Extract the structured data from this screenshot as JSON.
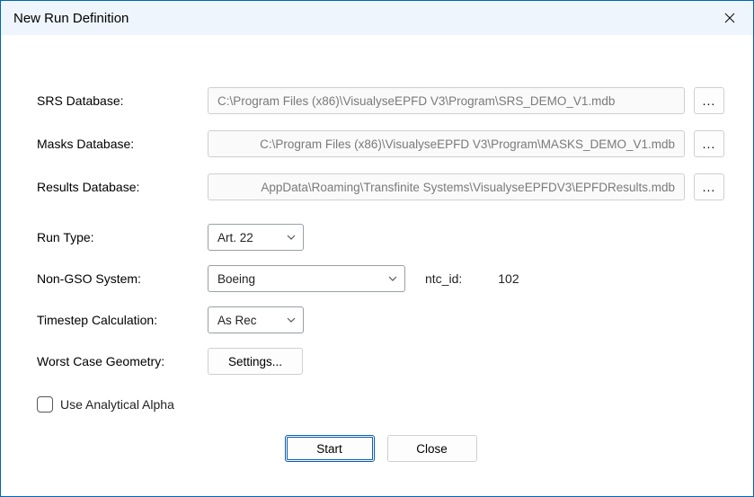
{
  "window": {
    "title": "New Run Definition"
  },
  "labels": {
    "srs_database": "SRS Database:",
    "masks_database": "Masks Database:",
    "results_database": "Results Database:",
    "run_type": "Run Type:",
    "non_gso_system": "Non-GSO System:",
    "ntc_id": "ntc_id:",
    "timestep_calc": "Timestep Calculation:",
    "worst_case_geometry": "Worst Case Geometry:",
    "use_analytical_alpha": "Use Analytical Alpha"
  },
  "values": {
    "srs_database": "C:\\Program Files (x86)\\VisualyseEPFD V3\\Program\\SRS_DEMO_V1.mdb",
    "masks_database": "C:\\Program Files (x86)\\VisualyseEPFD V3\\Program\\MASKS_DEMO_V1.mdb",
    "results_database": "AppData\\Roaming\\Transfinite Systems\\VisualyseEPFDV3\\EPFDResults.mdb",
    "run_type": "Art. 22",
    "non_gso_system": "Boeing",
    "ntc_id": "102",
    "timestep_calc": "As Rec",
    "use_analytical_alpha_checked": false
  },
  "buttons": {
    "browse": "...",
    "settings": "Settings...",
    "start": "Start",
    "close": "Close"
  }
}
